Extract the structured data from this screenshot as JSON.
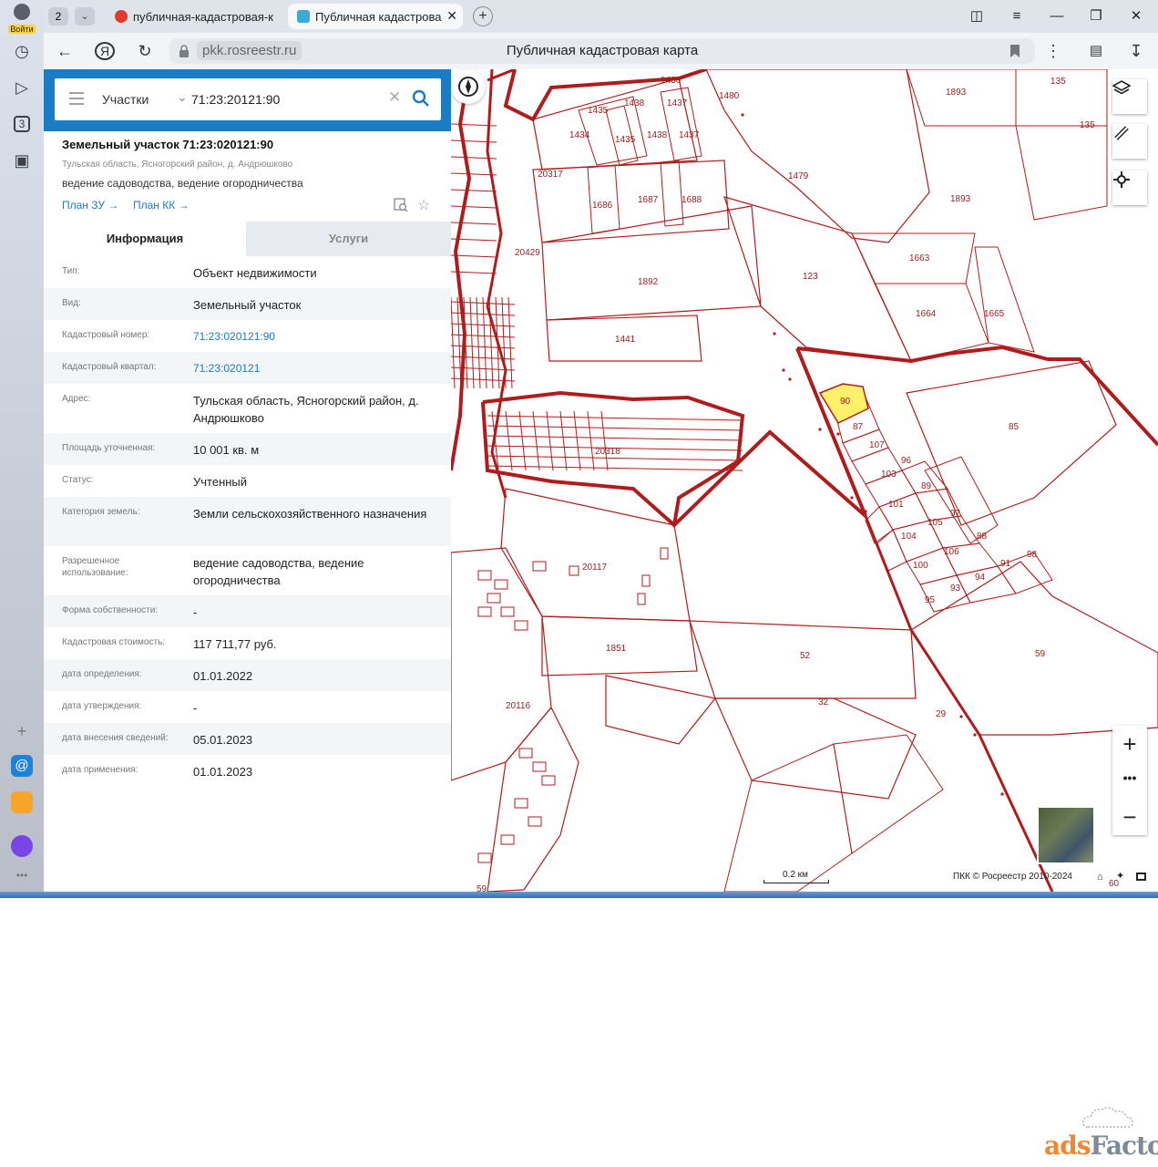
{
  "browser": {
    "login_label": "Войти",
    "tab_group_count": "2",
    "rail_count": "3",
    "tabs": [
      {
        "title": "публичная-кадастровая-к",
        "favicon": "yandex-icon"
      },
      {
        "title": "Публичная кадастрова",
        "favicon": "rosreestr-icon",
        "active": true
      }
    ],
    "url": "pkk.rosreestr.ru",
    "page_title": "Публичная кадастровая карта"
  },
  "search": {
    "layer": "Участки",
    "query": "71:23:20121:90"
  },
  "object": {
    "title": "Земельный участок 71:23:020121:90",
    "address": "Тульская область, Ясногорский район, д. Андрюшково",
    "use": "ведение садоводства, ведение огородничества",
    "plan_zu": "План ЗУ →",
    "plan_kk": "План КК →"
  },
  "tabs": {
    "info": "Информация",
    "services": "Услуги"
  },
  "details": [
    {
      "label": "Тип:",
      "value": "Объект недвижимости"
    },
    {
      "label": "Вид:",
      "value": "Земельный участок"
    },
    {
      "label": "Кадастровый номер:",
      "value": "71:23:020121:90",
      "link": true
    },
    {
      "label": "Кадастровый квартал:",
      "value": "71:23:020121",
      "link": true
    },
    {
      "label": "Адрес:",
      "value": "Тульская область, Ясногорский район, д. Андрюшково"
    },
    {
      "label": "Площадь уточненная:",
      "value": "10 001 кв. м"
    },
    {
      "label": "Статус:",
      "value": "Учтенный"
    },
    {
      "label": "Категория земель:",
      "value": "Земли сельскохозяйственного назначения"
    },
    {
      "label": "Разрешенное использование:",
      "value": "ведение садоводства, ведение огородничества"
    },
    {
      "label": "Форма собственности:",
      "value": "-"
    },
    {
      "label": "Кадастровая стоимость:",
      "value": "117 711,77 руб."
    },
    {
      "label": "дата определения:",
      "value": "01.01.2022"
    },
    {
      "label": "дата утверждения:",
      "value": "-"
    },
    {
      "label": "дата внесения сведений:",
      "value": "05.01.2023"
    },
    {
      "label": "дата применения:",
      "value": "01.01.2023"
    }
  ],
  "map": {
    "scale": "0.2 км",
    "copyright": "ПКК © Росреестр 2010-2024",
    "parcel_labels": [
      "1436",
      "1435",
      "1438",
      "1437",
      "1434",
      "1435",
      "1438",
      "1437",
      "1480",
      "1893",
      "135",
      "135",
      "1479",
      "1893",
      "20317",
      "1686",
      "1687",
      "1688",
      "123",
      "1663",
      "20429",
      "1892",
      "1664",
      "1665",
      "1441",
      "90",
      "85",
      "87",
      "107",
      "96",
      "103",
      "89",
      "20318",
      "101",
      "97",
      "105",
      "104",
      "88",
      "106",
      "98",
      "91",
      "100",
      "94",
      "93",
      "95",
      "20117",
      "59",
      "1851",
      "52",
      "32",
      "20116",
      "29",
      "59",
      "60"
    ],
    "selected_parcel": "90",
    "colors": {
      "boundary": "#b01c1c",
      "selected_fill": "#fff16a"
    }
  },
  "watermark": {
    "ads": "ads",
    "factory": "Factory"
  }
}
